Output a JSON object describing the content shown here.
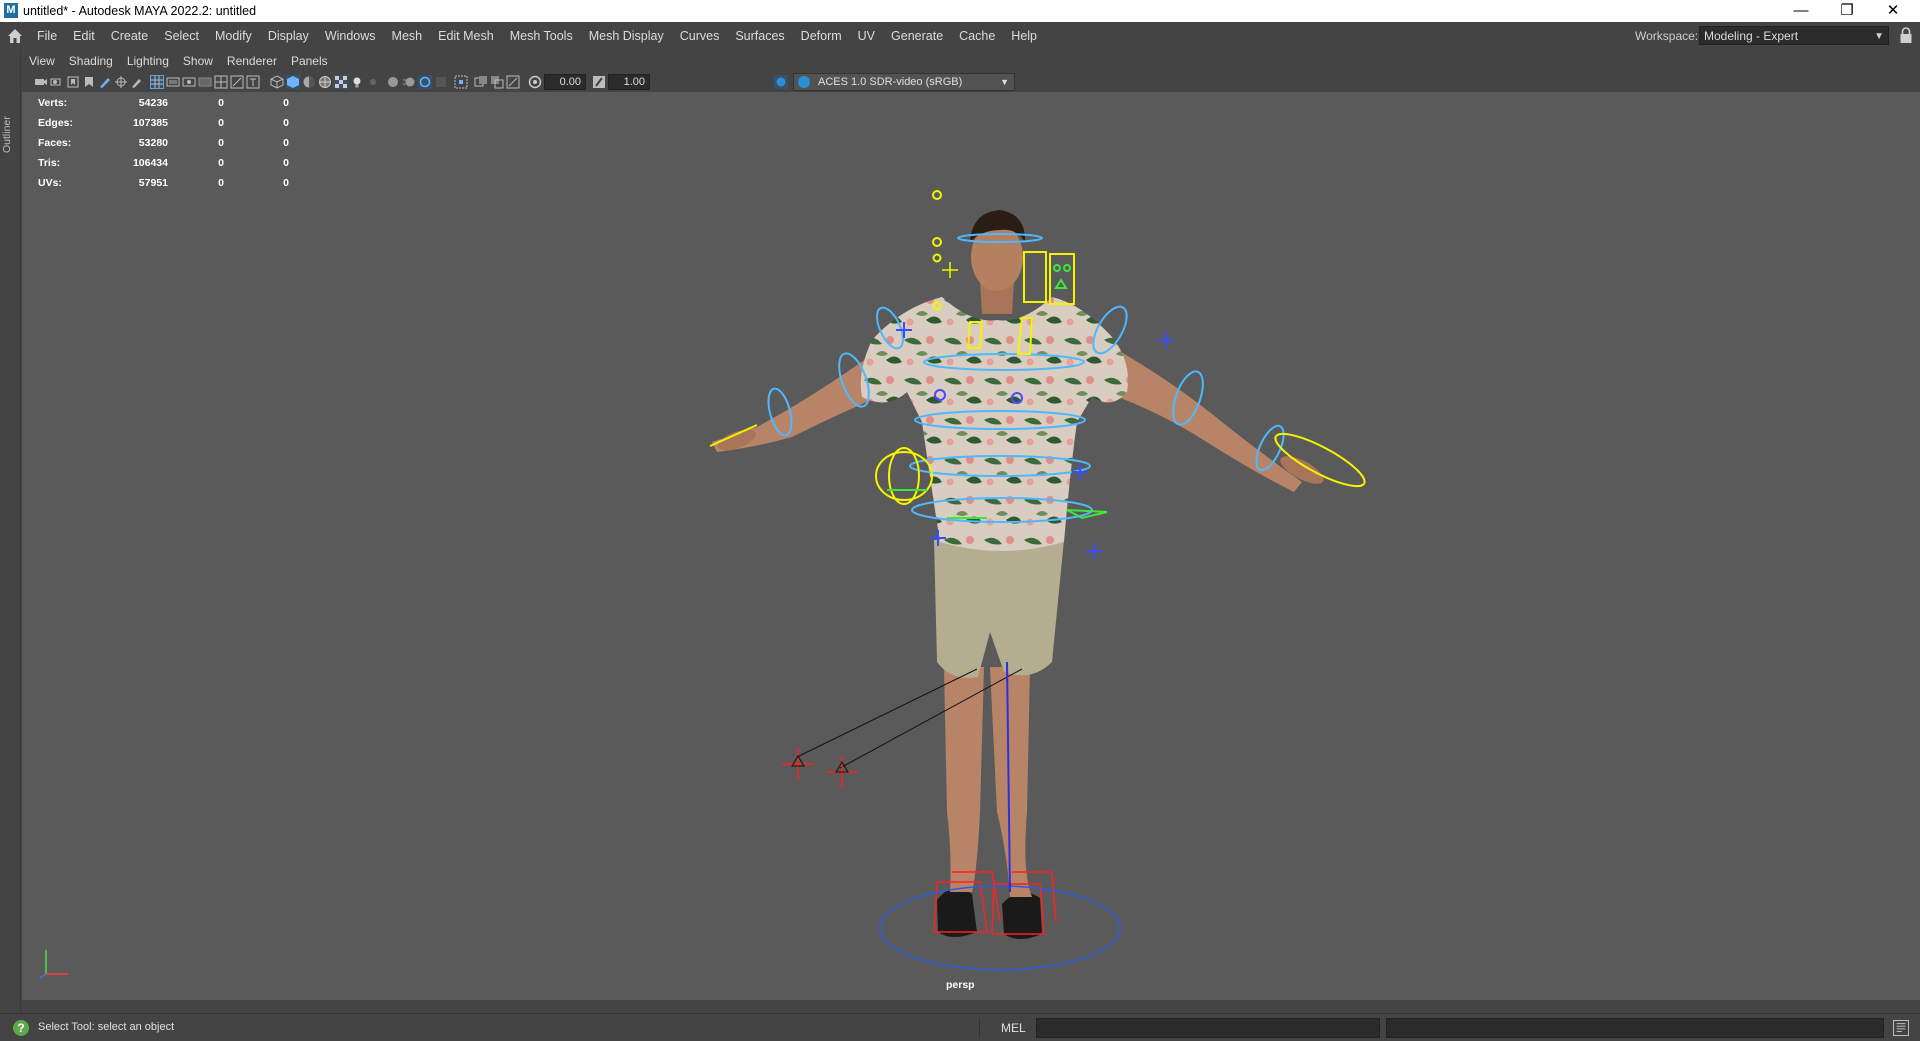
{
  "window": {
    "title": "untitled* - Autodesk MAYA 2022.2: untitled",
    "logo": "M",
    "controls": [
      "minimize-icon",
      "restore-icon",
      "close-icon"
    ]
  },
  "menubar": {
    "items": [
      "File",
      "Edit",
      "Create",
      "Select",
      "Modify",
      "Display",
      "Windows",
      "Mesh",
      "Edit Mesh",
      "Mesh Tools",
      "Mesh Display",
      "Curves",
      "Surfaces",
      "Deform",
      "UV",
      "Generate",
      "Cache",
      "Help"
    ],
    "workspace_label": "Workspace:",
    "workspace_value": "Modeling - Expert"
  },
  "side": {
    "outliner_label": "Outliner"
  },
  "panel_menu": [
    "View",
    "Shading",
    "Lighting",
    "Show",
    "Renderer",
    "Panels"
  ],
  "toolbar": {
    "exposure": "0.00",
    "gamma": "1.00",
    "color_space": "ACES 1.0 SDR-video (sRGB)"
  },
  "hud": {
    "rows": [
      {
        "label": "Verts:",
        "v1": "54236",
        "v2": "0",
        "v3": "0"
      },
      {
        "label": "Edges:",
        "v1": "107385",
        "v2": "0",
        "v3": "0"
      },
      {
        "label": "Faces:",
        "v1": "53280",
        "v2": "0",
        "v3": "0"
      },
      {
        "label": "Tris:",
        "v1": "106434",
        "v2": "0",
        "v3": "0"
      },
      {
        "label": "UVs:",
        "v1": "57951",
        "v2": "0",
        "v3": "0"
      }
    ]
  },
  "viewport": {
    "camera": "persp"
  },
  "statusbar": {
    "help_text": "Select Tool: select an object",
    "command_language": "MEL"
  },
  "colors": {
    "viewport_bg": "#5a5a5a",
    "ui_bg": "#444444",
    "rig_blue": "#4fb8ff",
    "rig_yellow": "#f4f400",
    "rig_green": "#3ee63e",
    "rig_red": "#ff2020"
  }
}
